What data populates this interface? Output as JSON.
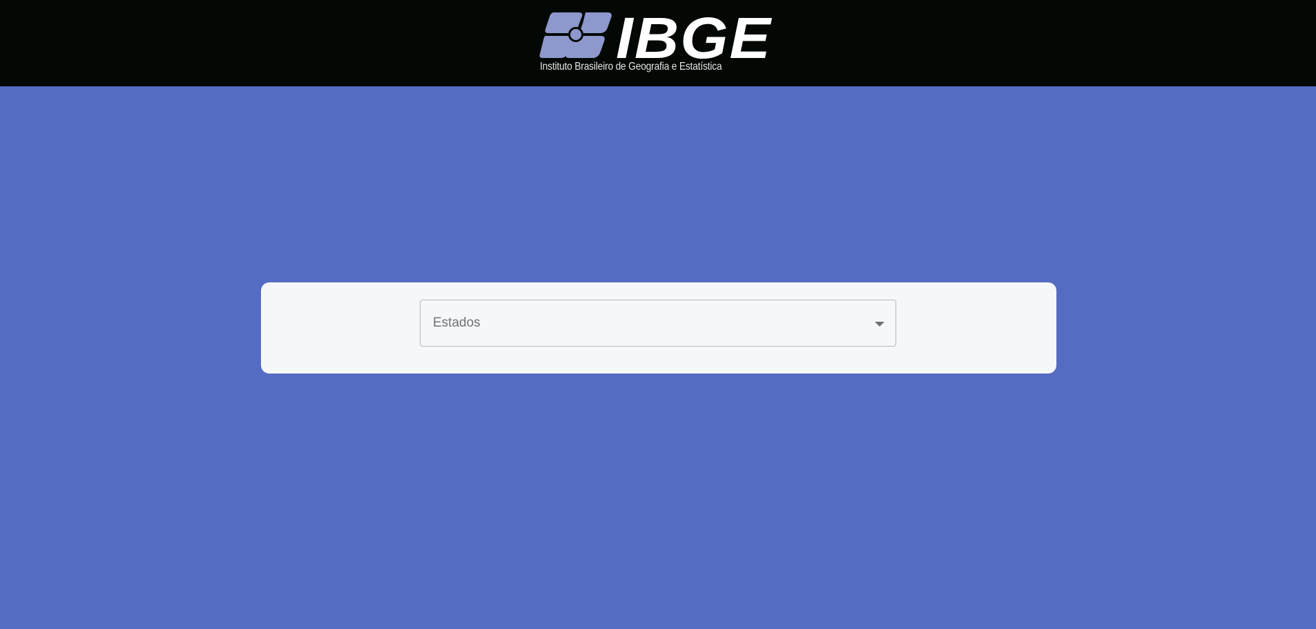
{
  "header": {
    "logo": {
      "wordmark": "IBGE",
      "caption": "Instituto Brasileiro de Geografia e Estatística",
      "colors": {
        "background": "#030804",
        "emblem": "#8e98cd",
        "wordmark": "#ffffff"
      }
    }
  },
  "main": {
    "background_color": "#556cc3",
    "state_select": {
      "placeholder": "Estados",
      "icon": "dropdown-arrow"
    }
  }
}
